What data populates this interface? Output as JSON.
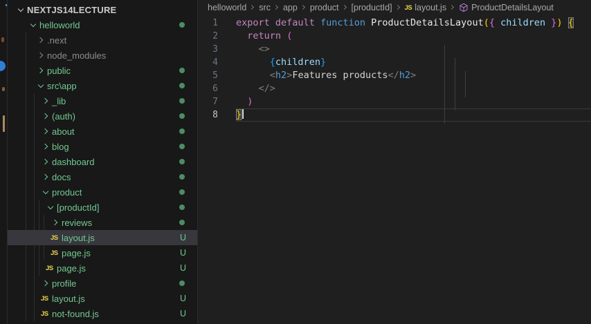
{
  "explorer": {
    "root_label": "NEXTJS14LECTURE",
    "untracked_badge": "U",
    "items": [
      {
        "label": "helloworld",
        "level": 1,
        "kind": "folder",
        "expanded": true,
        "tint": "green",
        "badge": "dot"
      },
      {
        "label": ".next",
        "level": 2,
        "kind": "folder",
        "expanded": false,
        "tint": "gray",
        "badge": "none"
      },
      {
        "label": "node_modules",
        "level": 2,
        "kind": "folder",
        "expanded": false,
        "tint": "gray",
        "badge": "none"
      },
      {
        "label": "public",
        "level": 2,
        "kind": "folder",
        "expanded": false,
        "tint": "green",
        "badge": "dot"
      },
      {
        "label": "src\\app",
        "level": 2,
        "kind": "folder",
        "expanded": true,
        "tint": "green",
        "badge": "dot"
      },
      {
        "label": "_lib",
        "level": 3,
        "kind": "folder",
        "expanded": false,
        "tint": "green",
        "badge": "dot"
      },
      {
        "label": "(auth)",
        "level": 3,
        "kind": "folder",
        "expanded": false,
        "tint": "green",
        "badge": "dot"
      },
      {
        "label": "about",
        "level": 3,
        "kind": "folder",
        "expanded": false,
        "tint": "green",
        "badge": "dot"
      },
      {
        "label": "blog",
        "level": 3,
        "kind": "folder",
        "expanded": false,
        "tint": "green",
        "badge": "dot"
      },
      {
        "label": "dashboard",
        "level": 3,
        "kind": "folder",
        "expanded": false,
        "tint": "green",
        "badge": "dot"
      },
      {
        "label": "docs",
        "level": 3,
        "kind": "folder",
        "expanded": false,
        "tint": "green",
        "badge": "dot"
      },
      {
        "label": "product",
        "level": 3,
        "kind": "folder",
        "expanded": true,
        "tint": "green",
        "badge": "dot"
      },
      {
        "label": "[productId]",
        "level": 4,
        "kind": "folder",
        "expanded": true,
        "tint": "green",
        "badge": "dot"
      },
      {
        "label": "reviews",
        "level": 5,
        "kind": "folder",
        "expanded": false,
        "tint": "green",
        "badge": "dot"
      },
      {
        "label": "layout.js",
        "level": 5,
        "kind": "file",
        "tint": "green",
        "badge": "U",
        "selected": true
      },
      {
        "label": "page.js",
        "level": 5,
        "kind": "file",
        "tint": "green",
        "badge": "U"
      },
      {
        "label": "page.js",
        "level": 4,
        "kind": "file",
        "tint": "green",
        "badge": "U"
      },
      {
        "label": "profile",
        "level": 3,
        "kind": "folder",
        "expanded": false,
        "tint": "green",
        "badge": "dot"
      },
      {
        "label": "layout.js",
        "level": 3,
        "kind": "file",
        "tint": "green",
        "badge": "U"
      },
      {
        "label": "not-found.js",
        "level": 3,
        "kind": "file",
        "tint": "green",
        "badge": "U"
      }
    ]
  },
  "breadcrumb": {
    "items": [
      {
        "label": "helloworld",
        "icon": "none"
      },
      {
        "label": "src",
        "icon": "none"
      },
      {
        "label": "app",
        "icon": "none"
      },
      {
        "label": "product",
        "icon": "none"
      },
      {
        "label": "[productId]",
        "icon": "none"
      },
      {
        "label": "layout.js",
        "icon": "js"
      },
      {
        "label": "ProductDetailsLayout",
        "icon": "symbol"
      }
    ]
  },
  "editor": {
    "active_line": 8,
    "lines": [
      {
        "n": 1,
        "tokens": [
          [
            "kw",
            "export"
          ],
          [
            "tx",
            " "
          ],
          [
            "kw",
            "default"
          ],
          [
            "tx",
            " "
          ],
          [
            "kb",
            "function"
          ],
          [
            "tx",
            " "
          ],
          [
            "fn",
            "ProductDetailsLayout"
          ],
          [
            "b1",
            "("
          ],
          [
            "b2",
            "{"
          ],
          [
            "tx",
            " "
          ],
          [
            "pr",
            "children"
          ],
          [
            "tx",
            " "
          ],
          [
            "b2",
            "}"
          ],
          [
            "b1",
            ")"
          ],
          [
            "tx",
            " "
          ],
          [
            "mb",
            "{"
          ]
        ]
      },
      {
        "n": 2,
        "tokens": [
          [
            "tx",
            "  "
          ],
          [
            "kw",
            "return"
          ],
          [
            "tx",
            " "
          ],
          [
            "b2",
            "("
          ]
        ]
      },
      {
        "n": 3,
        "tokens": [
          [
            "tx",
            "    "
          ],
          [
            "pu",
            "<>"
          ]
        ]
      },
      {
        "n": 4,
        "tokens": [
          [
            "tx",
            "      "
          ],
          [
            "b3",
            "{"
          ],
          [
            "pr",
            "children"
          ],
          [
            "b3",
            "}"
          ]
        ]
      },
      {
        "n": 5,
        "tokens": [
          [
            "tx",
            "      "
          ],
          [
            "pu",
            "<"
          ],
          [
            "kb",
            "h2"
          ],
          [
            "pu",
            ">"
          ],
          [
            "tx",
            "Features products"
          ],
          [
            "pu",
            "</"
          ],
          [
            "kb",
            "h2"
          ],
          [
            "pu",
            ">"
          ]
        ]
      },
      {
        "n": 6,
        "tokens": [
          [
            "tx",
            "    "
          ],
          [
            "pu",
            "</>"
          ]
        ]
      },
      {
        "n": 7,
        "tokens": [
          [
            "tx",
            "  "
          ],
          [
            "b2",
            ")"
          ]
        ]
      },
      {
        "n": 8,
        "tokens": [
          [
            "mb",
            "}"
          ]
        ],
        "cursor": true
      }
    ]
  },
  "colors": {
    "untracked_green": "#73C991",
    "ignored_gray": "#8C8C8C",
    "dot_badge": "#4d8c64",
    "js_icon_yellow": "#E8D44D",
    "symbol_purple": "#B180D7",
    "selection_bg": "#37373d",
    "editor_bg": "#1f1f1f",
    "sidebar_bg": "#181818"
  }
}
